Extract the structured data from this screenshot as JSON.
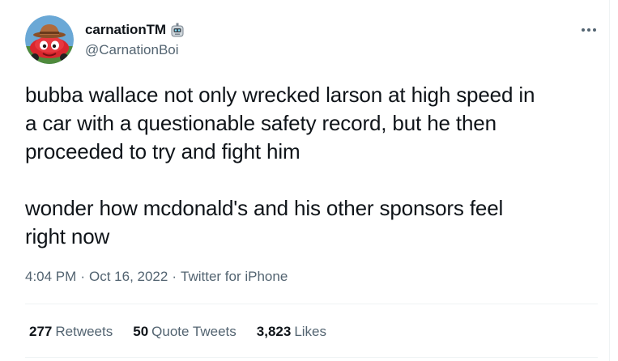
{
  "user": {
    "display_name": "carnationTM",
    "handle": "@CarnationBoi",
    "avatar_icon": "car-mascot-avatar-icon",
    "badge_icon": "robot-emoji-icon"
  },
  "menu": {
    "more_icon": "more-horizontal-icon"
  },
  "tweet": {
    "text": "bubba wallace not only wrecked larson at high speed in\na car with a questionable safety record, but he then\nproceeded to try and fight him\n\nwonder how mcdonald's and his other sponsors feel\nright now"
  },
  "meta": {
    "time": "4:04 PM",
    "separator": "·",
    "date": "Oct 16, 2022",
    "source": "Twitter for iPhone"
  },
  "stats": {
    "retweets_count": "277",
    "retweets_label": "Retweets",
    "quotes_count": "50",
    "quotes_label": "Quote Tweets",
    "likes_count": "3,823",
    "likes_label": "Likes"
  },
  "colors": {
    "text_primary": "#0f1419",
    "text_secondary": "#536471",
    "divider": "#eff3f4",
    "avatar_background": "#6aa8d6",
    "avatar_car": "#d9262e",
    "avatar_hat": "#b06a3b"
  }
}
